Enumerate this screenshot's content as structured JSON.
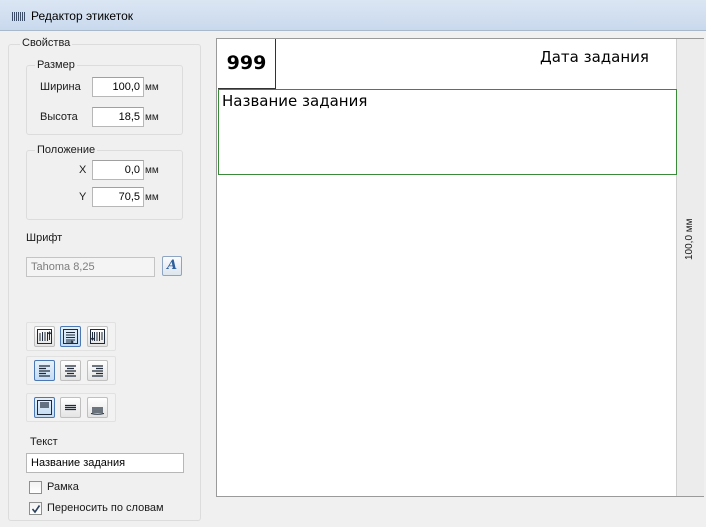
{
  "window": {
    "title": "Редактор этикеток"
  },
  "properties": {
    "group_label": "Свойства",
    "size": {
      "label": "Размер",
      "width_label": "Ширина",
      "width_value": "100,0",
      "height_label": "Высота",
      "height_value": "18,5",
      "unit": "мм"
    },
    "position": {
      "label": "Положение",
      "x_label": "X",
      "x_value": "0,0",
      "y_label": "Y",
      "y_value": "70,5",
      "unit": "мм"
    },
    "font": {
      "label": "Шрифт",
      "value": "Tahoma  8,25",
      "button_glyph": "A"
    },
    "text": {
      "label": "Текст",
      "value": "Название задания"
    },
    "frame_checkbox": {
      "label": "Рамка",
      "checked": false
    },
    "wrap_checkbox": {
      "label": "Переносить по словам",
      "checked": true
    }
  },
  "canvas": {
    "ruler_label": "100,0 мм",
    "field_number": "999",
    "field_date": "Дата задания",
    "field_name": "Название задания"
  },
  "colors": {
    "selection_border": "#3a8a3a",
    "active_button": "#4b78b3",
    "title_bar": "#c9d9ed"
  }
}
